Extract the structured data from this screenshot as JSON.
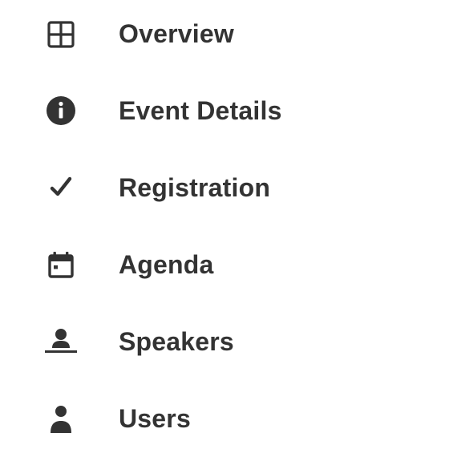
{
  "nav": {
    "items": [
      {
        "label": "Overview",
        "icon": "grid-icon"
      },
      {
        "label": "Event Details",
        "icon": "info-icon"
      },
      {
        "label": "Registration",
        "icon": "checkmark-icon"
      },
      {
        "label": "Agenda",
        "icon": "calendar-icon"
      },
      {
        "label": "Speakers",
        "icon": "speaker-icon"
      },
      {
        "label": "Users",
        "icon": "user-icon"
      }
    ]
  },
  "colors": {
    "text": "#333333",
    "icon": "#333333",
    "background": "#ffffff"
  }
}
